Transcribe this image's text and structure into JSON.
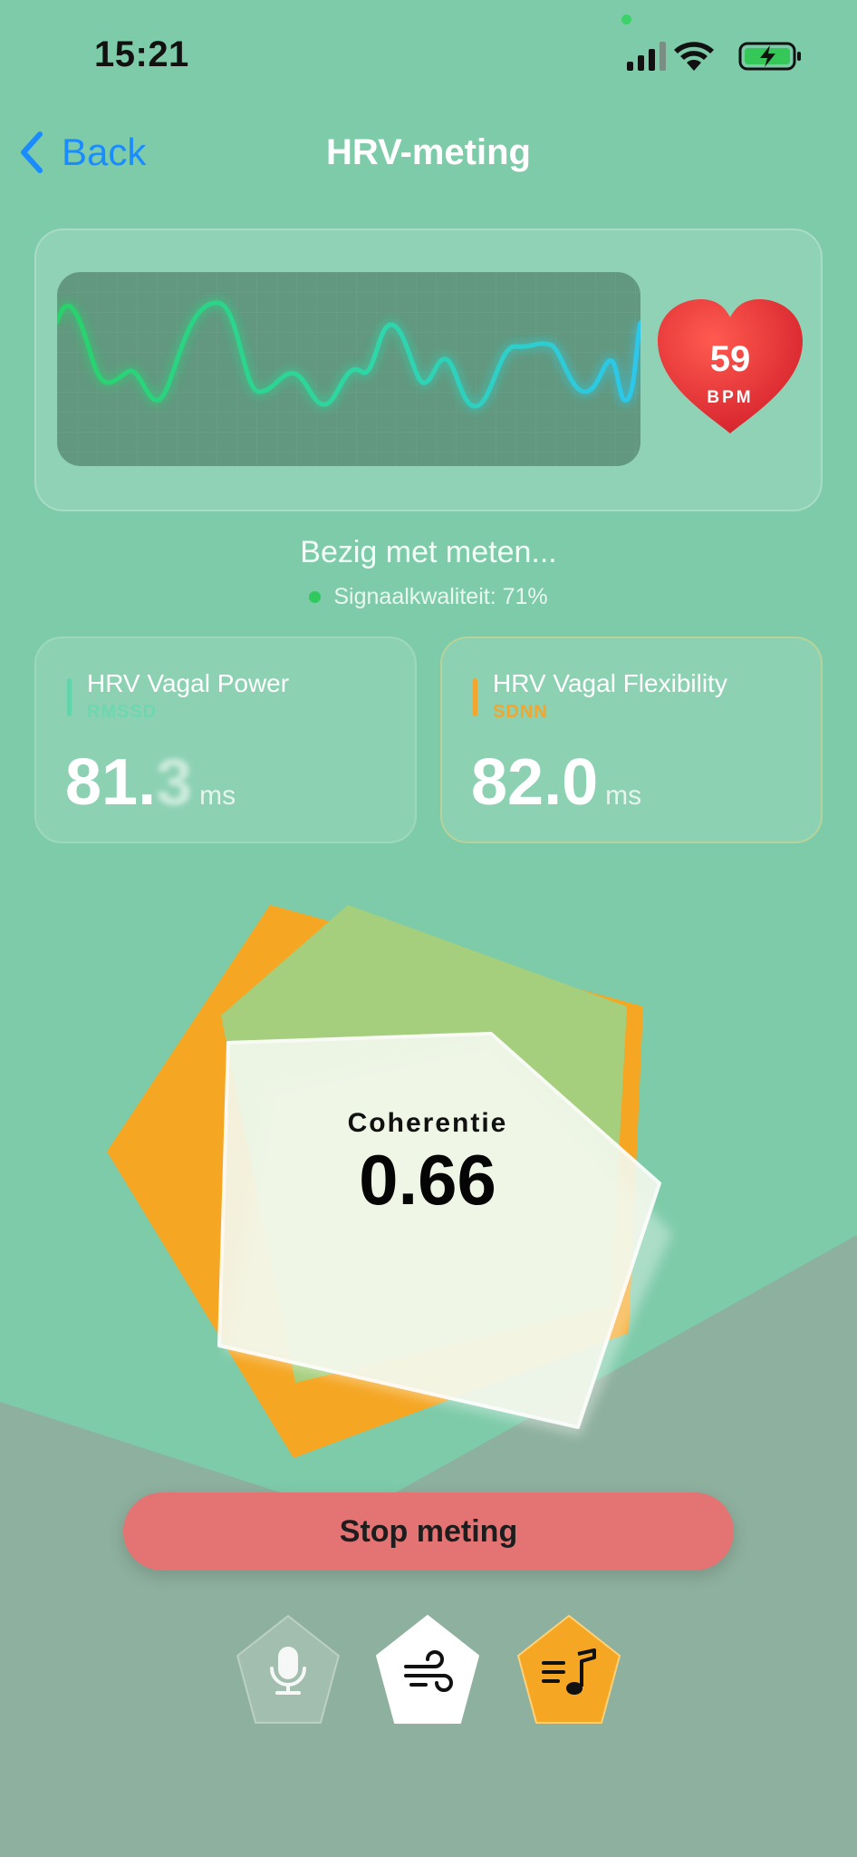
{
  "status_bar": {
    "time": "15:21"
  },
  "nav": {
    "back_label": "Back",
    "title": "HRV-meting"
  },
  "heart_rate": {
    "value": "59",
    "unit": "BPM"
  },
  "measurement": {
    "status_text": "Bezig met meten...",
    "signal_quality_text": "Signaalkwaliteit: 71%",
    "signal_quality": 0.71
  },
  "metrics": [
    {
      "title": "HRV Vagal Power",
      "subtitle": "RMSSD",
      "value_main": "81.",
      "value_fade": "3",
      "unit": "ms",
      "accent": "#45d9a6"
    },
    {
      "title": "HRV Vagal Flexibility",
      "subtitle": "SDNN",
      "value_main": "82.0",
      "value_fade": "",
      "unit": "ms",
      "accent": "#f4a52d"
    }
  ],
  "coherence": {
    "label": "Coherentie",
    "value": "0.66"
  },
  "actions": {
    "stop_label": "Stop meting"
  },
  "bottom_buttons": [
    {
      "icon": "microphone-icon"
    },
    {
      "icon": "wind-icon"
    },
    {
      "icon": "music-list-icon"
    }
  ],
  "colors": {
    "background": "#7ecba9",
    "lower_background": "#8eb09e",
    "orange": "#f5a623",
    "olive": "#a5cf7c",
    "stop_button": "#e47474",
    "heart": "#e63033",
    "wave_start": "#28d36a",
    "wave_end": "#2cc7ec"
  }
}
